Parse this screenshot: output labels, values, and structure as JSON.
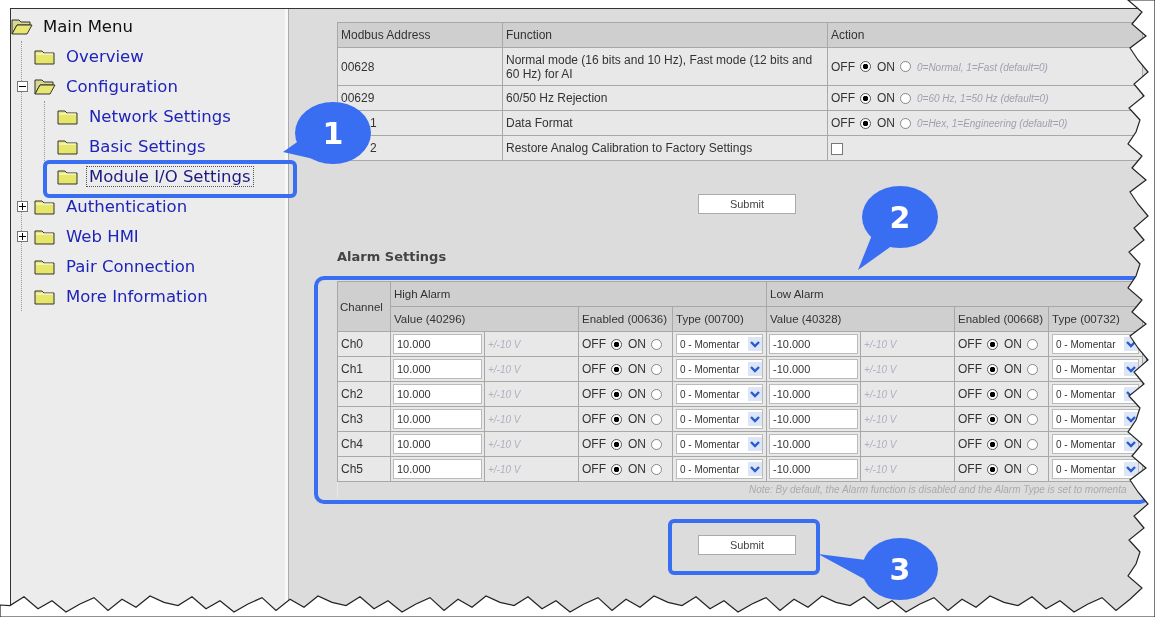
{
  "sidebar": {
    "root": {
      "label": "Main Menu",
      "selected": false,
      "children": [
        {
          "label": "Overview",
          "selected": false
        },
        {
          "label": "Configuration",
          "selected": false,
          "expanded": true,
          "children": [
            {
              "label": "Network Settings",
              "selected": false
            },
            {
              "label": "Basic Settings",
              "selected": false
            },
            {
              "label": "Module I/O Settings",
              "selected": true
            }
          ]
        },
        {
          "label": "Authentication",
          "selected": false,
          "expanded": false
        },
        {
          "label": "Web HMI",
          "selected": false,
          "expanded": false
        },
        {
          "label": "Pair Connection",
          "selected": false
        },
        {
          "label": "More Information",
          "selected": false
        }
      ]
    }
  },
  "mode_table": {
    "columns": [
      "Modbus Address",
      "Function",
      "Action"
    ],
    "rows": [
      {
        "address": "00628",
        "function": "Normal mode (16 bits and 10 Hz), Fast mode (12 bits and 60 Hz) for AI",
        "kind": "radio",
        "options": [
          {
            "label": "OFF",
            "selected": true
          },
          {
            "label": "ON",
            "selected": false
          }
        ],
        "hint": "0=Normal, 1=Fast (default=0)"
      },
      {
        "address": "00629",
        "function": "60/50 Hz Rejection",
        "kind": "radio",
        "options": [
          {
            "label": "OFF",
            "selected": true
          },
          {
            "label": "ON",
            "selected": false
          }
        ],
        "hint": "0=60 Hz, 1=50 Hz (default=0)"
      },
      {
        "address": "1",
        "function": "Data Format",
        "kind": "radio",
        "options": [
          {
            "label": "OFF",
            "selected": true
          },
          {
            "label": "ON",
            "selected": false
          }
        ],
        "hint": "0=Hex, 1=Engineering (default=0)"
      },
      {
        "address": "2",
        "function": "Restore Analog Calibration to Factory Settings",
        "kind": "checkbox",
        "checked": false
      }
    ],
    "submit": "Submit"
  },
  "alarm": {
    "title": "Alarm Settings",
    "channel_header": "Channel",
    "groups": [
      "High Alarm",
      "Low Alarm"
    ],
    "columns": [
      "Value (40296)",
      "Enabled (00636)",
      "Type (00700)",
      "Value (40328)",
      "Enabled (00668)",
      "Type (00732)"
    ],
    "rows": [
      {
        "channel": "Ch0",
        "high": {
          "value": "10.000",
          "range": "+/-10 V",
          "enabled": [
            {
              "label": "OFF",
              "selected": true
            },
            {
              "label": "ON",
              "selected": false
            }
          ],
          "type": "0 - Momentar"
        },
        "low": {
          "value": "-10.000",
          "range": "+/-10 V",
          "enabled": [
            {
              "label": "OFF",
              "selected": true
            },
            {
              "label": "ON",
              "selected": false
            }
          ],
          "type": "0 - Momentar"
        }
      },
      {
        "channel": "Ch1",
        "high": {
          "value": "10.000",
          "range": "+/-10 V",
          "enabled": [
            {
              "label": "OFF",
              "selected": true
            },
            {
              "label": "ON",
              "selected": false
            }
          ],
          "type": "0 - Momentar"
        },
        "low": {
          "value": "-10.000",
          "range": "+/-10 V",
          "enabled": [
            {
              "label": "OFF",
              "selected": true
            },
            {
              "label": "ON",
              "selected": false
            }
          ],
          "type": "0 - Momentar"
        }
      },
      {
        "channel": "Ch2",
        "high": {
          "value": "10.000",
          "range": "+/-10 V",
          "enabled": [
            {
              "label": "OFF",
              "selected": true
            },
            {
              "label": "ON",
              "selected": false
            }
          ],
          "type": "0 - Momentar"
        },
        "low": {
          "value": "-10.000",
          "range": "+/-10 V",
          "enabled": [
            {
              "label": "OFF",
              "selected": true
            },
            {
              "label": "ON",
              "selected": false
            }
          ],
          "type": "0 - Momentar"
        }
      },
      {
        "channel": "Ch3",
        "high": {
          "value": "10.000",
          "range": "+/-10 V",
          "enabled": [
            {
              "label": "OFF",
              "selected": true
            },
            {
              "label": "ON",
              "selected": false
            }
          ],
          "type": "0 - Momentar"
        },
        "low": {
          "value": "-10.000",
          "range": "+/-10 V",
          "enabled": [
            {
              "label": "OFF",
              "selected": true
            },
            {
              "label": "ON",
              "selected": false
            }
          ],
          "type": "0 - Momentar"
        }
      },
      {
        "channel": "Ch4",
        "high": {
          "value": "10.000",
          "range": "+/-10 V",
          "enabled": [
            {
              "label": "OFF",
              "selected": true
            },
            {
              "label": "ON",
              "selected": false
            }
          ],
          "type": "0 - Momentar"
        },
        "low": {
          "value": "-10.000",
          "range": "+/-10 V",
          "enabled": [
            {
              "label": "OFF",
              "selected": true
            },
            {
              "label": "ON",
              "selected": false
            }
          ],
          "type": "0 - Momentar"
        }
      },
      {
        "channel": "Ch5",
        "high": {
          "value": "10.000",
          "range": "+/-10 V",
          "enabled": [
            {
              "label": "OFF",
              "selected": true
            },
            {
              "label": "ON",
              "selected": false
            }
          ],
          "type": "0 - Momentar"
        },
        "low": {
          "value": "-10.000",
          "range": "+/-10 V",
          "enabled": [
            {
              "label": "OFF",
              "selected": true
            },
            {
              "label": "ON",
              "selected": false
            }
          ],
          "type": "0 - Momentar"
        }
      }
    ],
    "note": "Note: By default, the Alarm function is disabled and the Alarm Type is set to momenta",
    "submit": "Submit"
  },
  "callouts": [
    {
      "number": "1"
    },
    {
      "number": "2"
    },
    {
      "number": "3"
    }
  ]
}
